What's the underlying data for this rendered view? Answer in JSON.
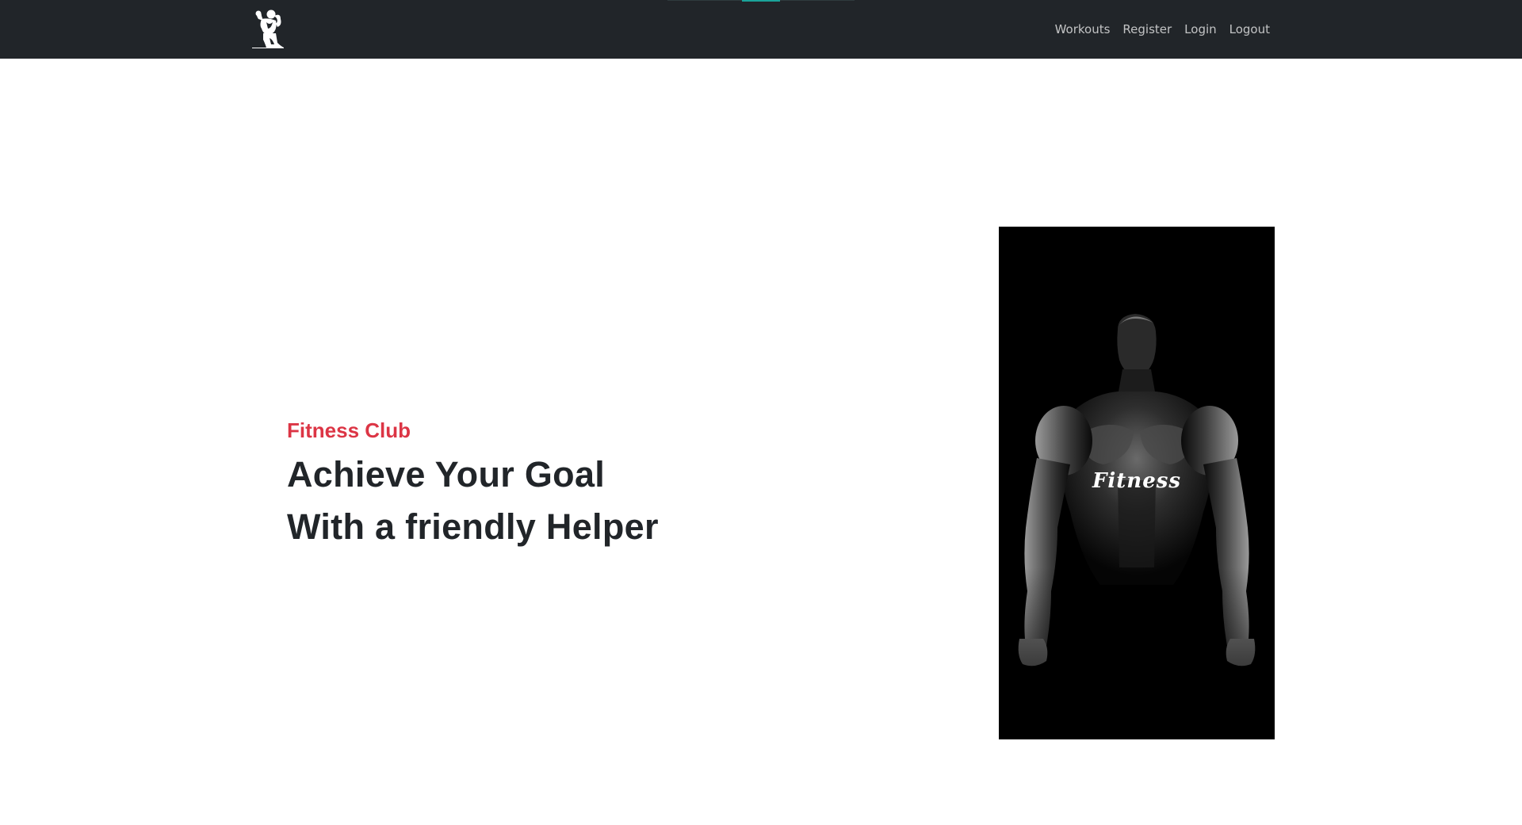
{
  "navbar": {
    "brand_icon": "bodybuilder-logo-icon",
    "links": [
      {
        "label": "Workouts"
      },
      {
        "label": "Register"
      },
      {
        "label": "Login"
      },
      {
        "label": "Logout"
      }
    ]
  },
  "hero": {
    "subtitle": "Fitness Club",
    "headline_line1": "Achieve Your Goal",
    "headline_line2": "With a friendly Helper",
    "image": {
      "overlay_text": "Fitness",
      "icon": "muscular-man-silhouette-image"
    }
  },
  "colors": {
    "navbar_bg": "#212529",
    "subtitle": "#dc3545",
    "headline": "#212529",
    "accent": "#1aa39a"
  }
}
